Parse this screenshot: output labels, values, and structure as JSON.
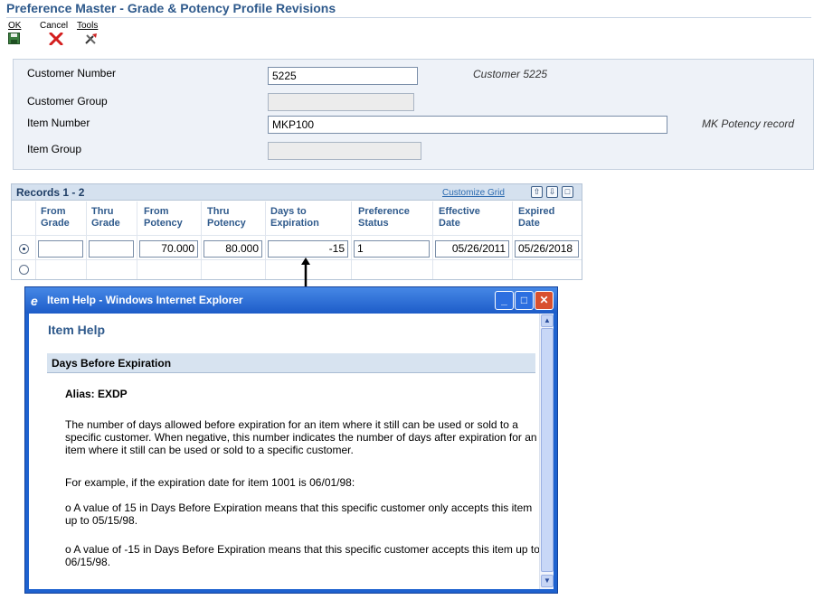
{
  "page": {
    "title": "Preference Master - Grade & Potency Profile Revisions"
  },
  "toolbar": {
    "ok_label": "OK",
    "cancel_label": "Cancel",
    "tools_label": "Tools"
  },
  "header": {
    "customer_number_label": "Customer Number",
    "customer_number_value": "5225",
    "customer_number_desc": "Customer 5225",
    "customer_group_label": "Customer Group",
    "customer_group_value": "",
    "item_number_label": "Item Number",
    "item_number_value": "MKP100",
    "item_number_desc": "MK Potency record",
    "item_group_label": "Item Group",
    "item_group_value": ""
  },
  "grid": {
    "caption": "Records 1 - 2",
    "customize_link": "Customize Grid",
    "columns": [
      [
        "From",
        "Grade"
      ],
      [
        "Thru",
        "Grade"
      ],
      [
        "From",
        "Potency"
      ],
      [
        "Thru",
        "Potency"
      ],
      [
        "Days to",
        "Expiration"
      ],
      [
        "Preference",
        "Status"
      ],
      [
        "Effective",
        "Date"
      ],
      [
        "Expired",
        "Date"
      ]
    ],
    "rows": [
      {
        "from_grade": "",
        "thru_grade": "",
        "from_potency": "70.000",
        "thru_potency": "80.000",
        "days_to_expiration": "-15",
        "preference_status": "1",
        "effective_date": "05/26/2011",
        "expired_date": "05/26/2018"
      }
    ]
  },
  "help_window": {
    "title": "Item Help - Windows Internet Explorer",
    "heading": "Item Help",
    "section": "Days Before Expiration",
    "alias": "Alias: EXDP",
    "p1": "The number of days allowed before expiration for an item where it still can be used or sold to a specific customer. When negative, this number indicates the number of days after expiration for an item where it still can be used or sold to a specific customer.",
    "p2": "For example, if the expiration date for item 1001 is 06/01/98:",
    "p3": "o A value of 15 in Days Before Expiration means that this specific customer only accepts this item up to 05/15/98.",
    "p4": "o A value of -15 in Days Before Expiration means that this specific customer accepts this item up to 06/15/98."
  },
  "colors": {
    "title": "#2f5a8c",
    "header_bg": "#eef2f8",
    "grid_caption": "#d5e1ef",
    "ie_frame": "#1e62cf"
  }
}
